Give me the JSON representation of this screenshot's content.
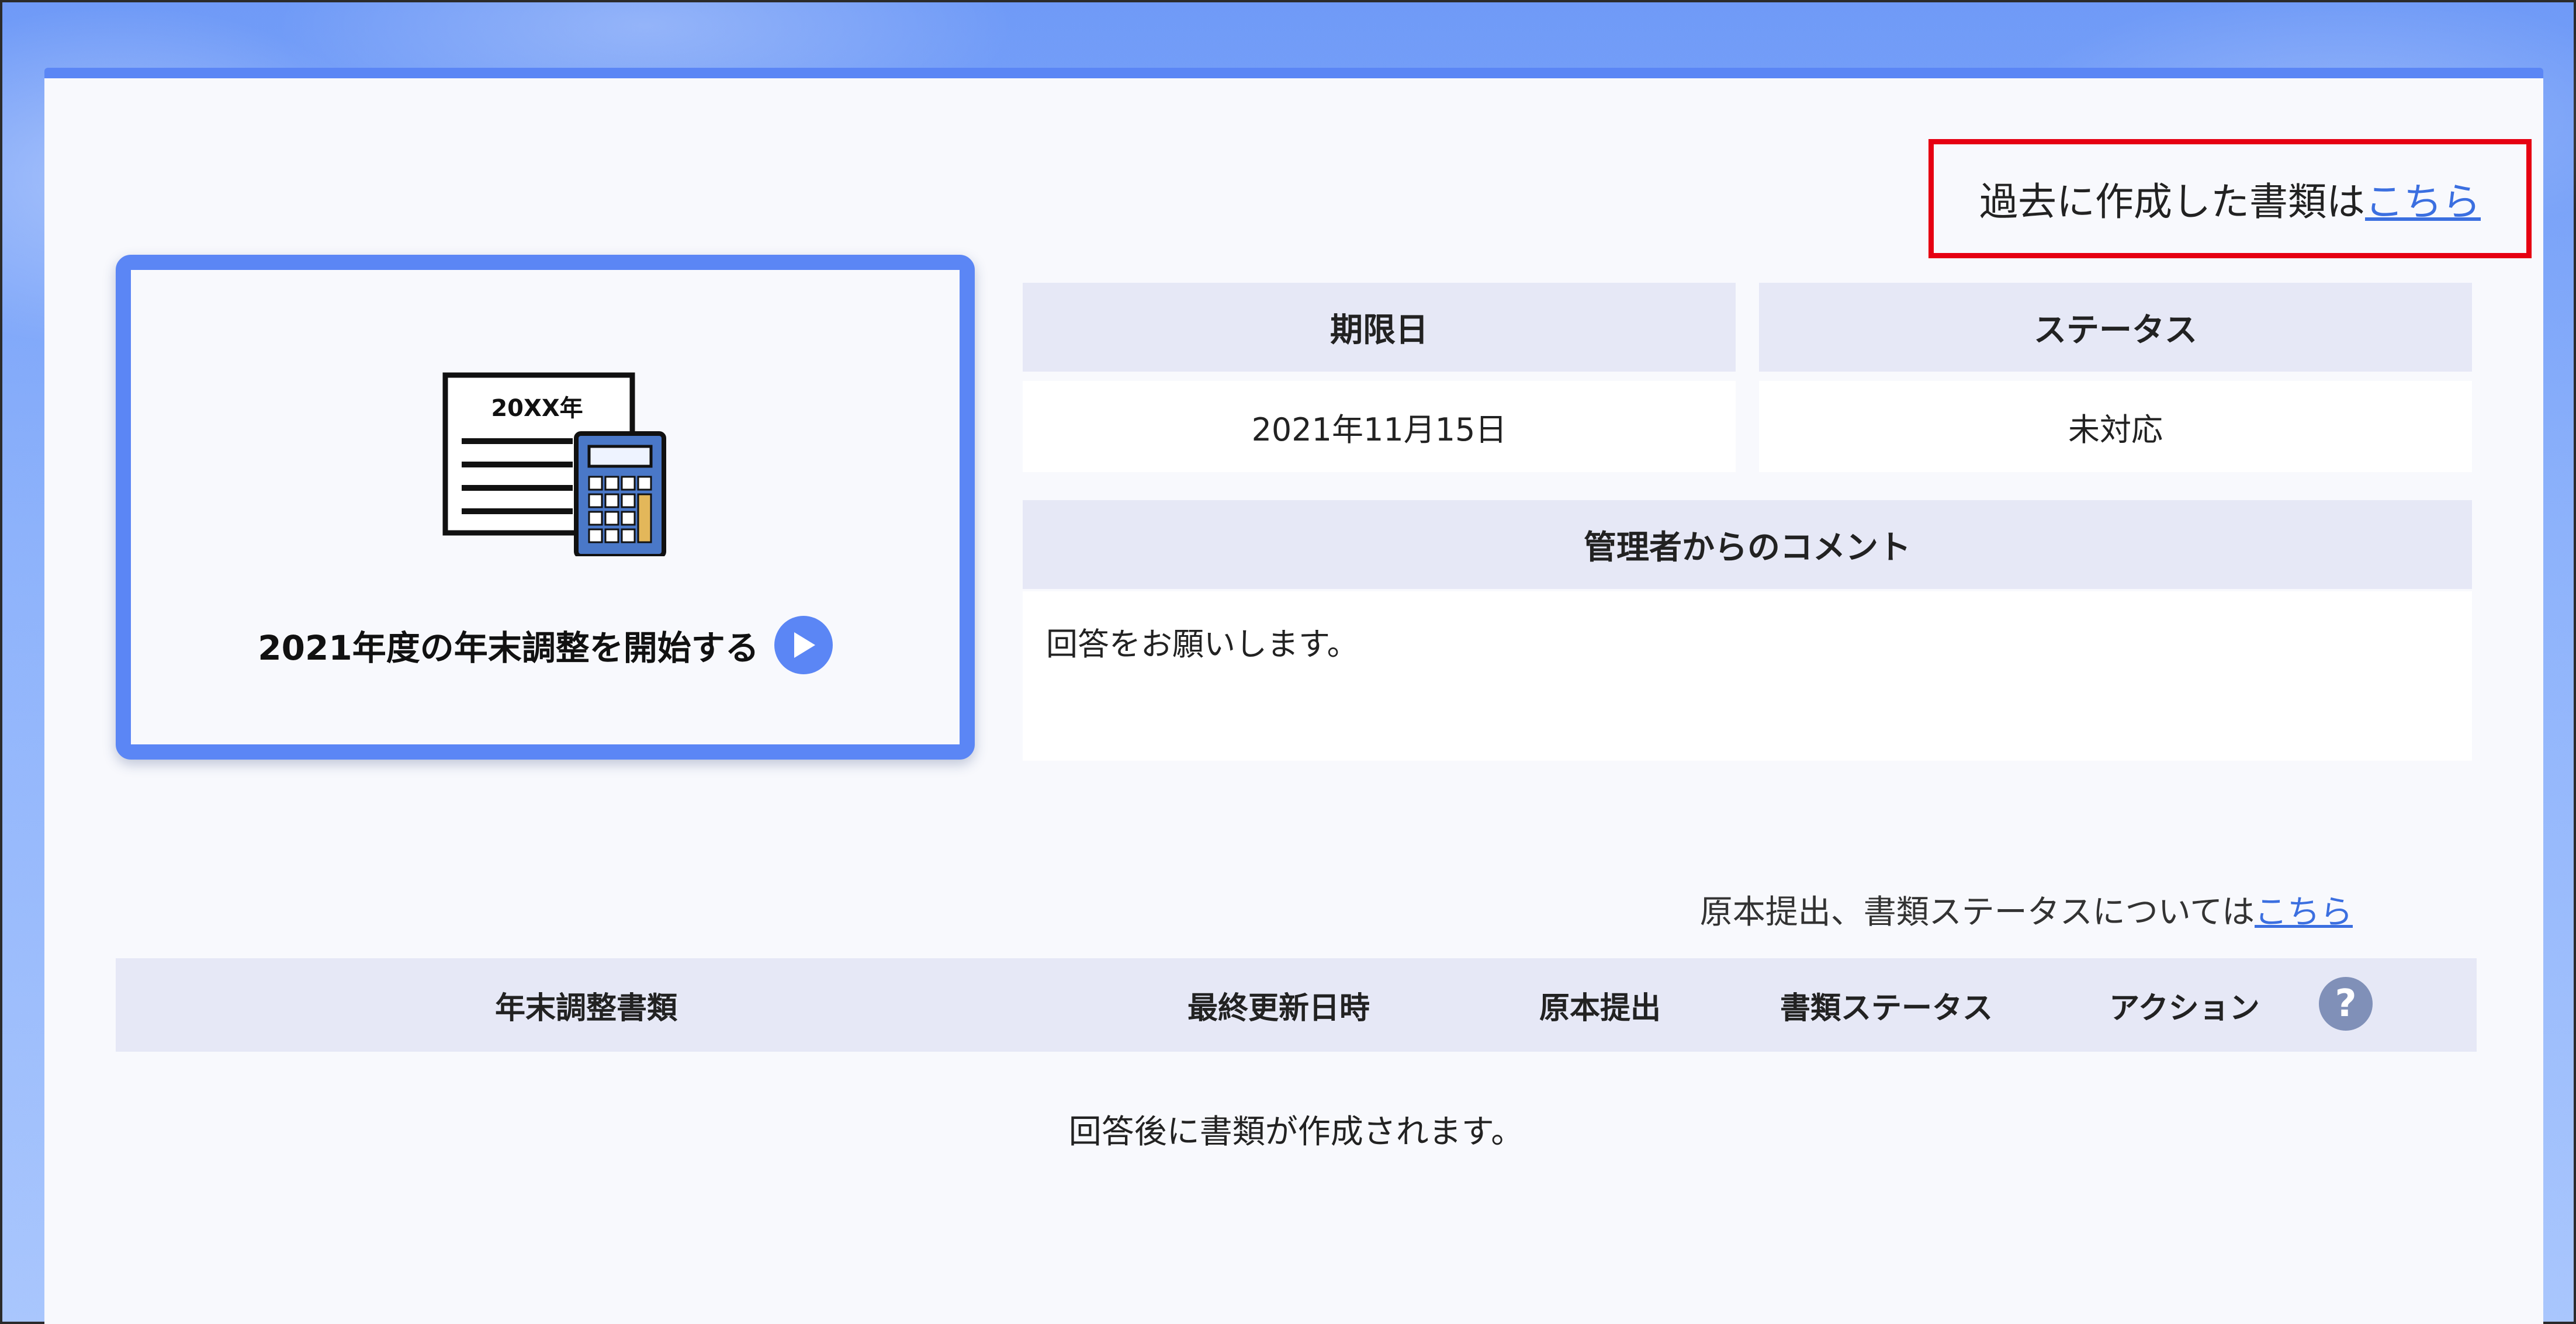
{
  "header": {
    "past_docs_text": "過去に作成した書類は",
    "past_docs_link": "こちら"
  },
  "start_card": {
    "illustration_label": "20XX年",
    "label": "2021年度の年末調整を開始する"
  },
  "info": {
    "deadline_label": "期限日",
    "deadline_value": "2021年11月15日",
    "status_label": "ステータス",
    "status_value": "未対応",
    "comment_label": "管理者からのコメント",
    "comment_value": "回答をお願いします。"
  },
  "status_note": {
    "text": "原本提出、書類ステータスについては",
    "link": "こちら"
  },
  "table": {
    "headers": [
      "年末調整書類",
      "最終更新日時",
      "原本提出",
      "書類ステータス",
      "アクション"
    ],
    "help_label": "?",
    "empty_message": "回答後に書類が作成されます。"
  },
  "colors": {
    "accent": "#5b86f5",
    "highlight": "#e60012",
    "link": "#3b6fe0",
    "header_bg": "#e6e8f6"
  }
}
